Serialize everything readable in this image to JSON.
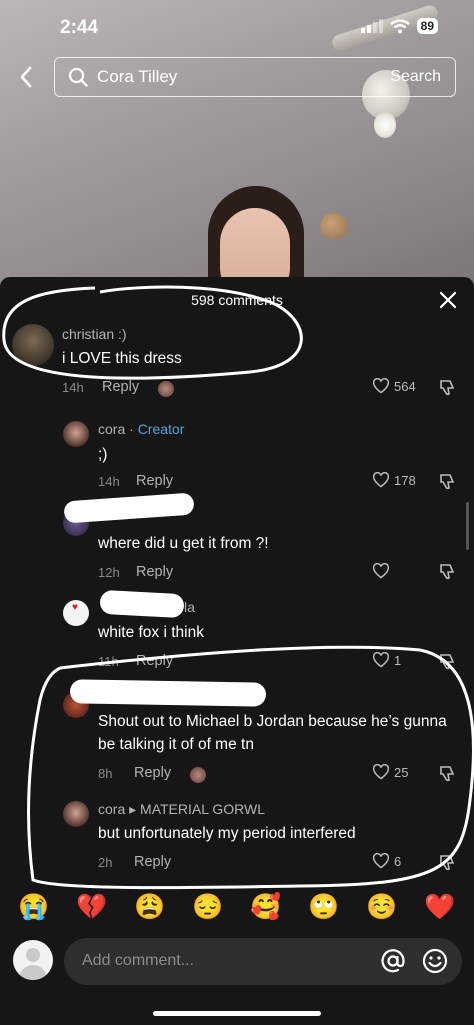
{
  "status": {
    "time": "2:44",
    "battery": "89"
  },
  "search": {
    "query": "Cora Tilley",
    "button": "Search"
  },
  "panel": {
    "title": "598 comments"
  },
  "comments": [
    {
      "user": "christian :)",
      "text": "i LOVE this dress",
      "time": "14h",
      "reply": "Reply",
      "likes": "564"
    },
    {
      "user": "cora",
      "badge": "Creator",
      "text": ";)",
      "time": "14h",
      "reply": "Reply",
      "likes": "178"
    },
    {
      "user": "",
      "text": "where did u get it from ?!",
      "time": "12h",
      "reply": "Reply",
      "likes": ""
    },
    {
      "user": "la",
      "text": "white fox i think",
      "time": "11h",
      "reply": "Reply",
      "likes": "1"
    },
    {
      "user": "",
      "text": "Shout out to Michael b Jordan because he’s gunna be talking it of of me tn",
      "time": "8h",
      "reply": "Reply",
      "likes": "25"
    },
    {
      "user": "cora",
      "reply_to": "MATERIAL GORWL",
      "text": "but unfortunately my period interfered",
      "time": "2h",
      "reply": "Reply",
      "likes": "6"
    }
  ],
  "emojis": [
    "😭",
    "💔",
    "😩",
    "😔",
    "🥰",
    "🙄",
    "☺️",
    "❤️"
  ],
  "composer": {
    "placeholder": "Add comment..."
  },
  "colors": {
    "panel": "#161616",
    "creator": "#4fa6d8",
    "composer": "#2e2e2e"
  },
  "icons": [
    "back-arrow-icon",
    "search-icon",
    "close-icon",
    "heart-outline-icon",
    "dislike-icon",
    "at-icon",
    "emoji-icon"
  ]
}
